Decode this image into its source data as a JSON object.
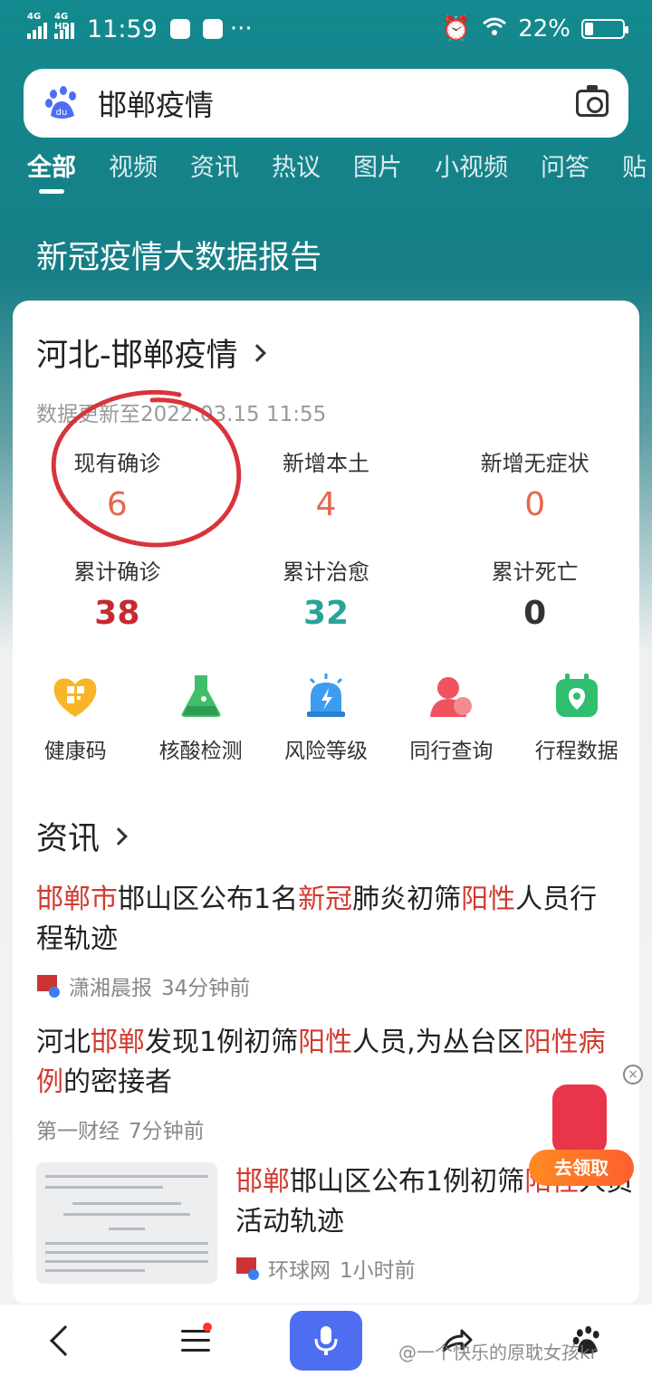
{
  "status_bar": {
    "network1": "4G",
    "network2": "4G HD",
    "time": "11:59",
    "battery_text": "22%",
    "battery_level": 0.22
  },
  "search": {
    "query": "邯郸疫情"
  },
  "tabs": [
    "全部",
    "视频",
    "资讯",
    "热议",
    "图片",
    "小视频",
    "问答",
    "贴"
  ],
  "active_tab": "全部",
  "banner": {
    "title": "新冠疫情大数据报告"
  },
  "card": {
    "title": "河北-邯郸疫情",
    "update_time": "数据更新至2022.03.15 11:55",
    "stats": [
      {
        "label": "现有确诊",
        "value": "6",
        "color": "#e7674d"
      },
      {
        "label": "新增本土",
        "value": "4",
        "color": "#e7674d"
      },
      {
        "label": "新增无症状",
        "value": "0",
        "color": "#e7674d"
      },
      {
        "label": "累计确诊",
        "value": "38",
        "color": "#c8292f"
      },
      {
        "label": "累计治愈",
        "value": "32",
        "color": "#2aa39a"
      },
      {
        "label": "累计死亡",
        "value": "0",
        "color": "#333333"
      }
    ],
    "tools": [
      {
        "label": "健康码",
        "icon": "health-code-icon",
        "color": "#f9b528"
      },
      {
        "label": "核酸检测",
        "icon": "flask-icon",
        "color": "#3fbf6a"
      },
      {
        "label": "风险等级",
        "icon": "alarm-icon",
        "color": "#3c9cf0"
      },
      {
        "label": "同行查询",
        "icon": "person-icon",
        "color": "#f0535e"
      },
      {
        "label": "行程数据",
        "icon": "location-icon",
        "color": "#2fbf6e"
      }
    ]
  },
  "news_section": {
    "title": "资讯",
    "items": [
      {
        "title_parts": [
          {
            "text": "邯郸市",
            "hl": true
          },
          {
            "text": "邯山区公布1名",
            "hl": false
          },
          {
            "text": "新冠",
            "hl": true
          },
          {
            "text": "肺炎初筛",
            "hl": false
          },
          {
            "text": "阳性",
            "hl": true
          },
          {
            "text": "人员行程轨迹",
            "hl": false
          }
        ],
        "source": "潇湘晨报",
        "time": "34分钟前"
      },
      {
        "title_parts": [
          {
            "text": "河北",
            "hl": false
          },
          {
            "text": "邯郸",
            "hl": true
          },
          {
            "text": "发现1例初筛",
            "hl": false
          },
          {
            "text": "阳性",
            "hl": true
          },
          {
            "text": "人员,为丛台区",
            "hl": false
          },
          {
            "text": "阳性病例",
            "hl": true
          },
          {
            "text": "的密接者",
            "hl": false
          }
        ],
        "source": "第一财经",
        "time": "7分钟前"
      },
      {
        "title_parts": [
          {
            "text": "邯郸",
            "hl": true
          },
          {
            "text": "邯山区公布1例初筛",
            "hl": false
          },
          {
            "text": "阳性",
            "hl": true
          },
          {
            "text": "人员活动轨迹",
            "hl": false
          }
        ],
        "source": "环球网",
        "time": "1小时前"
      }
    ]
  },
  "promo": {
    "label": "去领取"
  },
  "watermark": "@一个快乐的原耽女孩kr"
}
